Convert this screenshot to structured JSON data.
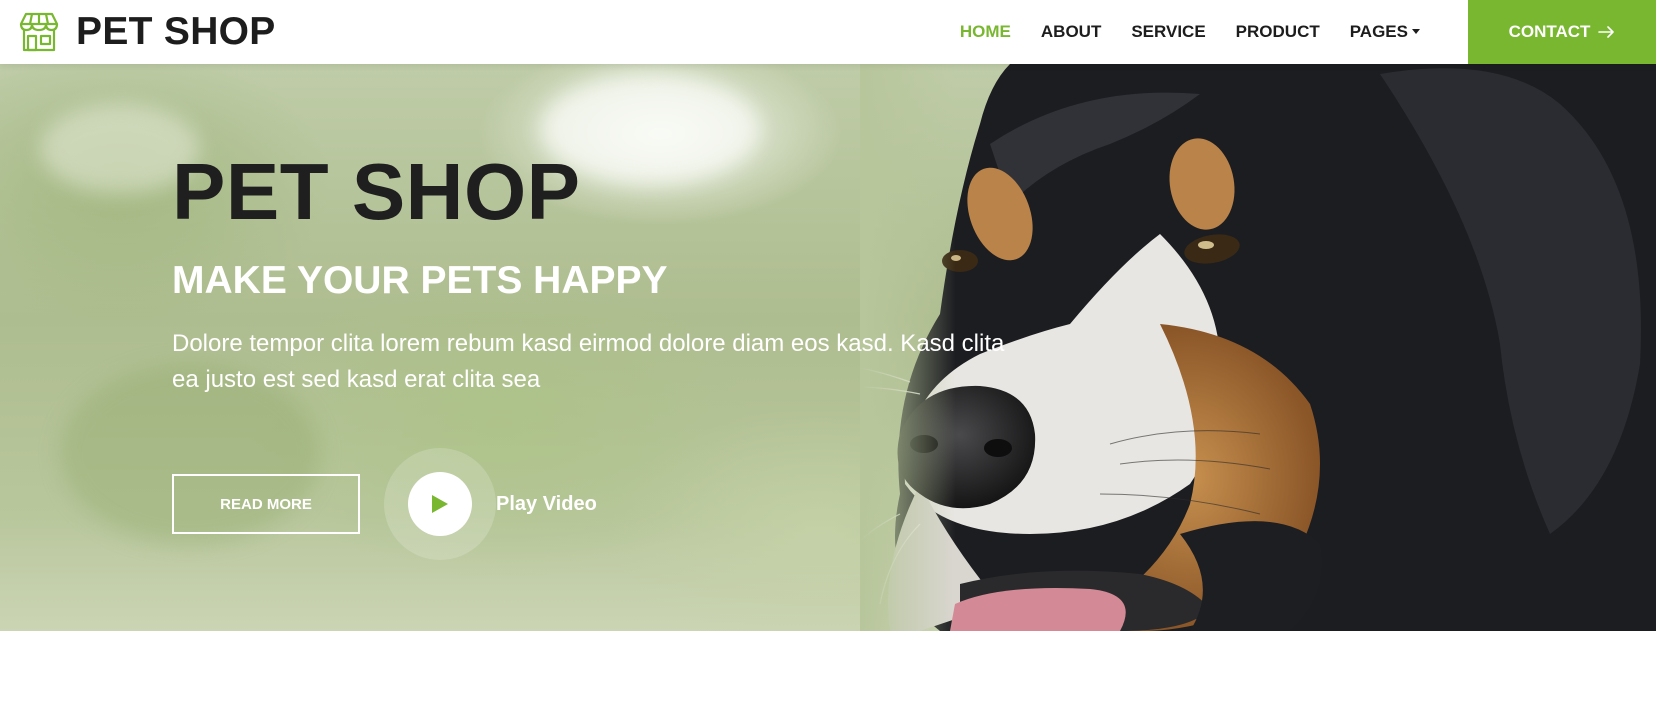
{
  "brand": {
    "name": "PET SHOP",
    "icon": "storefront-icon",
    "accent_color": "#7ab730"
  },
  "nav": {
    "items": [
      {
        "label": "HOME",
        "active": true
      },
      {
        "label": "ABOUT",
        "active": false
      },
      {
        "label": "SERVICE",
        "active": false
      },
      {
        "label": "PRODUCT",
        "active": false
      },
      {
        "label": "PAGES",
        "active": false,
        "dropdown": true
      }
    ],
    "contact_label": "CONTACT",
    "contact_icon": "arrow-right-icon"
  },
  "hero": {
    "title": "PET SHOP",
    "subtitle": "MAKE YOUR PETS HAPPY",
    "text": "Dolore tempor clita lorem rebum kasd eirmod dolore diam eos kasd. Kasd clita ea justo est sed kasd erat clita sea",
    "read_more_label": "READ MORE",
    "play_label": "Play Video",
    "play_icon": "play-icon",
    "image": "dog-photo"
  }
}
